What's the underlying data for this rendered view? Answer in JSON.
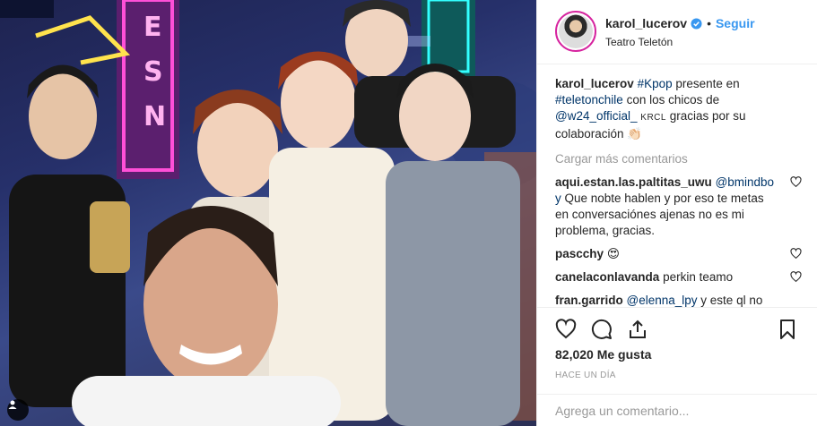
{
  "post": {
    "image_alt": "Selfie at Teatro Teletón with K-pop group W24",
    "tag_icon": "person-tag-icon"
  },
  "header": {
    "username": "karol_lucerov",
    "verified_icon": "verified-badge-icon",
    "separator": "•",
    "follow_label": "Seguir",
    "location": "Teatro Teletón"
  },
  "caption": {
    "username": "karol_lucerov",
    "parts": {
      "hashtag1": "#Kpop",
      "text1": " presente en ",
      "hashtag2": "#teletonchile",
      "text2": " con los chicos de ",
      "mention": "@w24_official_",
      "text3": " ",
      "krcl": "KRCL",
      "text4": " gracias por su colaboración ",
      "emoji": "👏🏻"
    }
  },
  "load_more": "Cargar más comentarios",
  "comments": [
    {
      "user": "aqui.estan.las.paltitas_uwu",
      "mention": "@bmindbo y",
      "text": " Que nobte hablen y por eso te metas en conversaciónes ajenas no es mi problema, gracias."
    },
    {
      "user": "pascchy",
      "mention": "",
      "text": " 😍"
    },
    {
      "user": "canelaconlavanda",
      "mention": "",
      "text": " perkin teamo"
    },
    {
      "user": "fran.garrido",
      "mention": "@elenna_lpy",
      "text": " y este ql no sabe que las flaites son todas iguales"
    }
  ],
  "actions": {
    "like_icon": "heart-icon",
    "comment_icon": "comment-icon",
    "share_icon": "share-icon",
    "save_icon": "bookmark-icon"
  },
  "likes": "82,020 Me gusta",
  "timestamp": "HACE UN DÍA",
  "add_comment": {
    "placeholder": "Agrega un comentario..."
  }
}
